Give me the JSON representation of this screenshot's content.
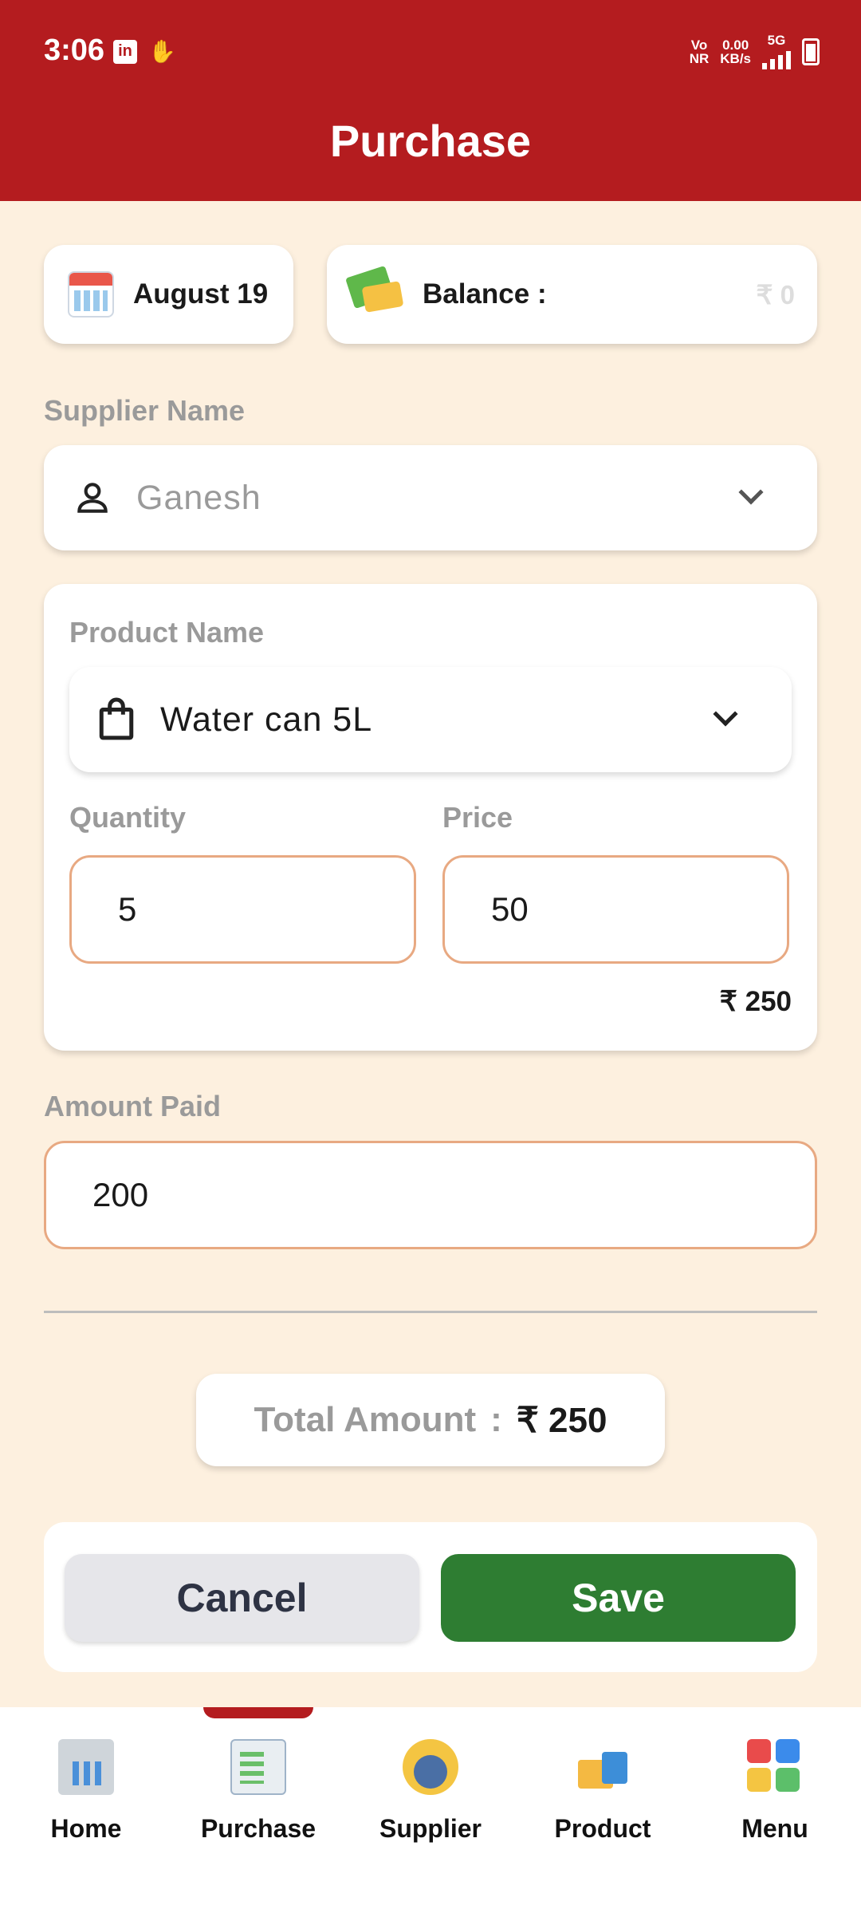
{
  "status_bar": {
    "time": "3:06",
    "network_top": "Vo",
    "network_bottom": "NR",
    "speed_top": "0.00",
    "speed_bottom": "KB/s",
    "signal_label": "5G",
    "icons": [
      "linkedin-icon",
      "hand-icon",
      "signal-icon",
      "battery-icon"
    ]
  },
  "header": {
    "title": "Purchase"
  },
  "date_card": {
    "label": "August 19",
    "icon": "calendar-icon"
  },
  "balance_card": {
    "label": "Balance :",
    "value": "₹ 0",
    "icon": "money-icon"
  },
  "supplier": {
    "label": "Supplier Name",
    "placeholder": "Ganesh",
    "icon": "person-icon"
  },
  "product": {
    "label": "Product Name",
    "value": "Water can 5L",
    "icon": "shopping-bag-icon",
    "quantity_label": "Quantity",
    "quantity_value": "5",
    "price_label": "Price",
    "price_value": "50",
    "line_total": "₹ 250"
  },
  "amount_paid": {
    "label": "Amount Paid",
    "value": "200"
  },
  "total": {
    "label": "Total Amount",
    "separator": ":",
    "value": "₹ 250"
  },
  "actions": {
    "cancel_label": "Cancel",
    "save_label": "Save"
  },
  "colors": {
    "primary": "#B41C1F",
    "background": "#FDF0DF",
    "save": "#2E7D32",
    "cancel": "#E6E6EA",
    "input_border": "#E8A982"
  },
  "bottom_nav": {
    "items": [
      {
        "label": "Home",
        "icon": "home-dashboard-icon"
      },
      {
        "label": "Purchase",
        "icon": "purchase-checklist-icon",
        "active": true
      },
      {
        "label": "Supplier",
        "icon": "supplier-people-icon"
      },
      {
        "label": "Product",
        "icon": "product-box-icon"
      },
      {
        "label": "Menu",
        "icon": "menu-grid-icon"
      }
    ]
  }
}
